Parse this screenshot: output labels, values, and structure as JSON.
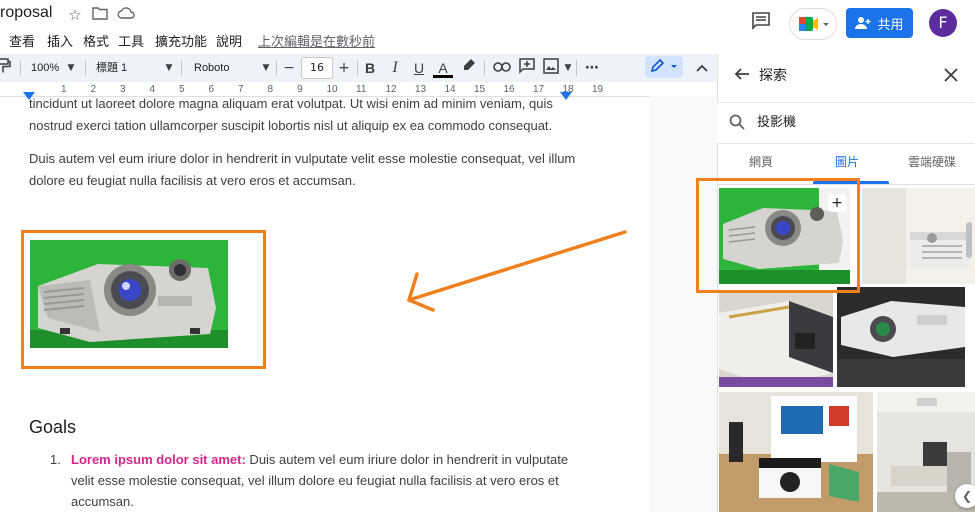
{
  "app": {
    "doc_title": "roposal",
    "menu": [
      "查看",
      "插入",
      "格式",
      "工具",
      "擴充功能",
      "說明"
    ],
    "last_edit": "上次編輯是在數秒前",
    "share_label": "共用",
    "avatar_letter": "F"
  },
  "toolbar": {
    "zoom": "100%",
    "style": "標題 1",
    "font": "Roboto",
    "font_size": "16",
    "minus": "−",
    "plus": "+",
    "bold": "B",
    "italic": "I",
    "underline": "U",
    "text_color": "A",
    "more": "⋯"
  },
  "ruler": {
    "ticks": [
      "1",
      "2",
      "3",
      "4",
      "5",
      "6",
      "7",
      "8",
      "9",
      "10",
      "11",
      "12",
      "13",
      "14",
      "15",
      "16",
      "17",
      "18",
      "19"
    ]
  },
  "document": {
    "para1_line1": "tincidunt ut laoreet dolore magna aliquam erat volutpat. Ut wisi enim ad minim veniam, quis",
    "para1_line2": "nostrud exerci tation ullamcorper suscipit lobortis nisl ut aliquip ex ea commodo consequat.",
    "para2_line1": "Duis autem vel eum iriure dolor in hendrerit in vulputate velit esse molestie consequat, vel illum",
    "para2_line2": "dolore eu feugiat nulla facilisis at vero eros et accumsan.",
    "heading": "Goals",
    "list_number": "1.",
    "list_bold": "Lorem ipsum dolor sit amet:",
    "list_line1": " Duis autem vel eum iriure dolor in hendrerit in vulputate",
    "list_line2": "velit esse molestie consequat, vel illum dolore eu feugiat nulla facilisis at vero eros et",
    "list_line3": "accumsan."
  },
  "panel": {
    "title": "探索",
    "search_value": "投影機",
    "tabs": [
      "網頁",
      "圖片",
      "雲端硬碟"
    ],
    "active_tab": 1
  },
  "colors": {
    "accent": "#1a73e8",
    "highlight": "#f07f1e",
    "bold_pink": "#d6268b",
    "toolbar_bg": "#eef2f9"
  }
}
